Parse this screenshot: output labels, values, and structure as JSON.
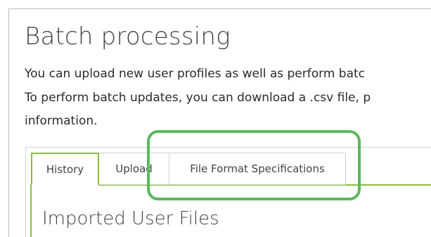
{
  "page": {
    "title": "Batch processing",
    "description_lines": [
      "You can upload new user profiles as well as perform batc",
      "To perform batch updates, you can download a .csv file, p",
      "information."
    ]
  },
  "tabs": [
    {
      "label": "History",
      "active": true
    },
    {
      "label": "Upload",
      "active": false
    },
    {
      "label": "File Format Specifications",
      "active": false
    }
  ],
  "content": {
    "section_title": "Imported User Files"
  },
  "colors": {
    "accent_green": "#8bbd3c",
    "highlight_green": "#5cb85c"
  }
}
